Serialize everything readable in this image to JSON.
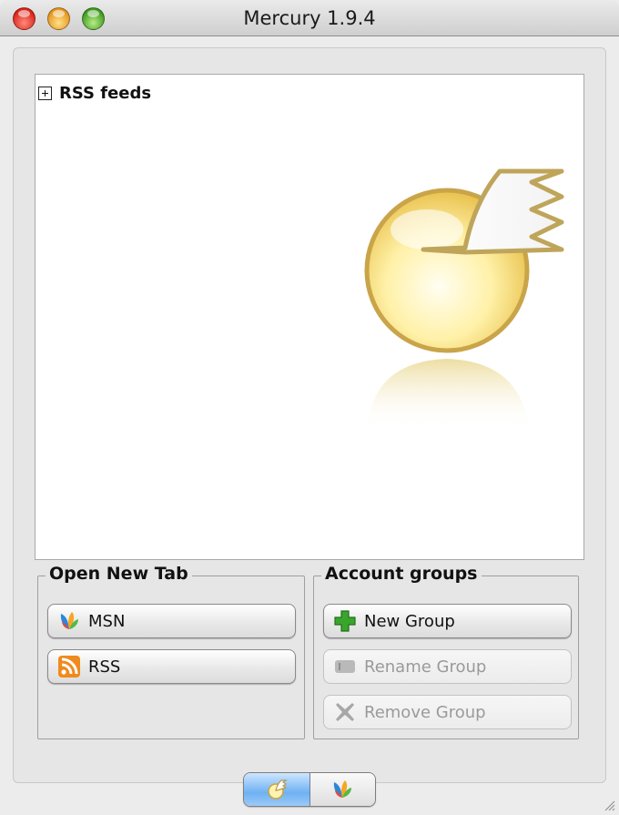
{
  "window": {
    "title": "Mercury 1.9.4"
  },
  "tree": {
    "root_label": "RSS feeds"
  },
  "open_new_tab": {
    "title": "Open New Tab",
    "buttons": [
      {
        "label": "MSN",
        "icon": "msn-butterfly-icon"
      },
      {
        "label": "RSS",
        "icon": "rss-icon"
      }
    ]
  },
  "account_groups": {
    "title": "Account groups",
    "buttons": [
      {
        "label": "New Group",
        "icon": "plus-icon",
        "enabled": true
      },
      {
        "label": "Rename Group",
        "icon": "rename-icon",
        "enabled": false
      },
      {
        "label": "Remove Group",
        "icon": "remove-x-icon",
        "enabled": false
      }
    ]
  },
  "bottom_tabs": [
    {
      "icon": "mercury-logo-icon",
      "selected": true
    },
    {
      "icon": "msn-butterfly-icon",
      "selected": false
    }
  ],
  "colors": {
    "accent_blue": "#6fb1f2",
    "rss_orange": "#f08a1c",
    "plus_green": "#3aa52c"
  }
}
